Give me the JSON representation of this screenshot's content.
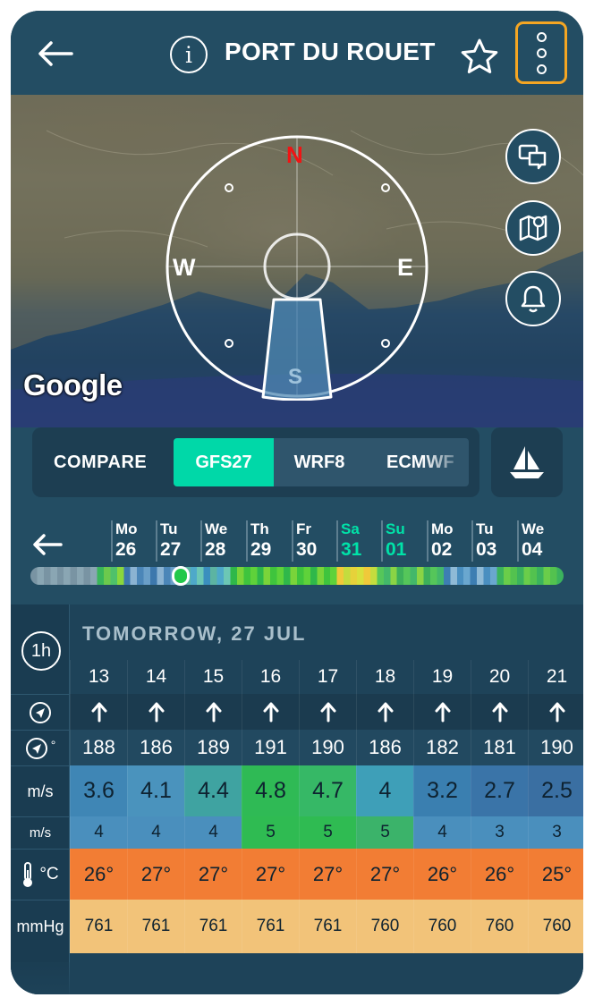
{
  "header": {
    "title": "PORT DU ROUET",
    "info_glyph": "i"
  },
  "map": {
    "google_label": "Google",
    "compass": {
      "n": "N",
      "e": "E",
      "s": "S",
      "w": "W"
    }
  },
  "models": {
    "compare": "COMPARE",
    "items": [
      "GFS27",
      "WRF8",
      "ECMWF"
    ],
    "selected": "GFS27"
  },
  "days": [
    {
      "name": "Mo",
      "date": "26"
    },
    {
      "name": "Tu",
      "date": "27"
    },
    {
      "name": "We",
      "date": "28"
    },
    {
      "name": "Th",
      "date": "29"
    },
    {
      "name": "Fr",
      "date": "30"
    },
    {
      "name": "Sa",
      "date": "31"
    },
    {
      "name": "Su",
      "date": "01"
    },
    {
      "name": "Mo",
      "date": "02"
    },
    {
      "name": "Tu",
      "date": "03"
    },
    {
      "name": "We",
      "date": "04"
    }
  ],
  "table": {
    "interval": "1h",
    "date_label": "TOMORROW, 27 JUL",
    "row_labels": {
      "dir_unit": "°",
      "speed_unit": "m/s",
      "gust_unit": "m/s",
      "temp_unit": "°C",
      "pressure_unit": "mmHg"
    },
    "hours": [
      "13",
      "14",
      "15",
      "16",
      "17",
      "18",
      "19",
      "20",
      "21"
    ],
    "directions": [
      "188",
      "186",
      "189",
      "191",
      "190",
      "186",
      "182",
      "181",
      "190"
    ],
    "speeds": [
      "3.6",
      "4.1",
      "4.4",
      "4.8",
      "4.7",
      "4",
      "3.2",
      "2.7",
      "2.5"
    ],
    "gusts": [
      "4",
      "4",
      "4",
      "5",
      "5",
      "5",
      "4",
      "3",
      "3"
    ],
    "temps": [
      "26°",
      "27°",
      "27°",
      "27°",
      "27°",
      "27°",
      "26°",
      "26°",
      "25°"
    ],
    "pressures": [
      "761",
      "761",
      "761",
      "761",
      "761",
      "760",
      "760",
      "760",
      "760"
    ]
  },
  "colors": {
    "accent": "#00d8a8",
    "highlight": "#f5a623",
    "temp": "#f27d34",
    "pressure": "#f2c379"
  }
}
